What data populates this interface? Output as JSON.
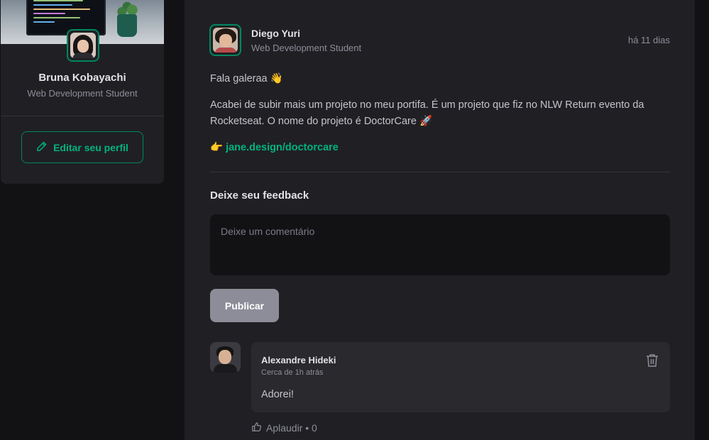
{
  "profile": {
    "name": "Bruna Kobayachi",
    "role": "Web Development Student",
    "edit_label": "Editar seu perfil"
  },
  "post": {
    "author_name": "Diego Yuri",
    "author_role": "Web Development Student",
    "time": "há 11 dias",
    "paragraphs": [
      "Fala galeraa 👋",
      "Acabei de subir mais um projeto no meu portifa. É um projeto que fiz no NLW Return evento da Rocketseat. O nome do projeto é DoctorCare 🚀"
    ],
    "link_prefix": "👉",
    "link_text": "jane.design/doctorcare"
  },
  "feedback": {
    "title": "Deixe seu feedback",
    "placeholder": "Deixe um comentário",
    "publish_label": "Publicar"
  },
  "comment": {
    "author": "Alexandre Hideki",
    "time": "Cerca de 1h atrás",
    "text": "Adorei!",
    "applaud_label": "Aplaudir • 0"
  },
  "colors": {
    "brand_green": "#00b37e",
    "border_green": "#00875f",
    "background": "#121214",
    "card": "#202024"
  }
}
